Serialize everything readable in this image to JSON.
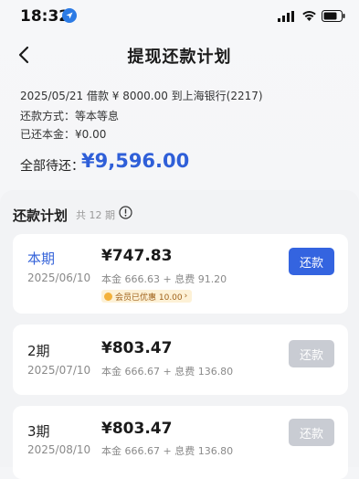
{
  "status_bar": {
    "time": "18:32"
  },
  "nav": {
    "title": "提现还款计划"
  },
  "loan": {
    "line1": "2025/05/21 借款 ¥ 8000.00 到上海银行(2217)",
    "line2": "还款方式：等本等息",
    "line3": "已还本金：¥0.00",
    "total_label": "全部待还：",
    "total_value": "¥9,596.00"
  },
  "plan": {
    "title": "还款计划",
    "count": "共 12 期",
    "items": [
      {
        "period": "本期",
        "date": "2025/06/10",
        "amount": "¥747.83",
        "breakdown": "本金 666.63 + 息费 91.20",
        "badge": "会员已优惠 10.00",
        "button": "还款",
        "enabled": true
      },
      {
        "period": "2期",
        "date": "2025/07/10",
        "amount": "¥803.47",
        "breakdown": "本金 666.67 + 息费 136.80",
        "button": "还款",
        "enabled": false
      },
      {
        "period": "3期",
        "date": "2025/08/10",
        "amount": "¥803.47",
        "breakdown": "本金 666.67 + 息费 136.80",
        "button": "还款",
        "enabled": false
      }
    ]
  },
  "colors": {
    "accent": "#3464e0",
    "total": "#2f5fd8",
    "disabled_button": "#c9ccd3",
    "badge_bg": "#fdf1d6"
  }
}
